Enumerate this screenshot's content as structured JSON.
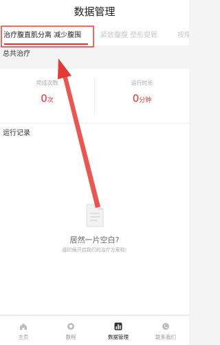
{
  "header": {
    "title": "数据管理"
  },
  "tabs": [
    {
      "label": "治疗腹直肌分离 减少腹围",
      "active": true
    },
    {
      "label": "紧致腹腹 塑形提臀",
      "active": false
    },
    {
      "label": "按摩",
      "active": false
    }
  ],
  "summary": {
    "title": "总共治疗",
    "completed": {
      "label": "完成次数",
      "value": "0",
      "unit": "次"
    },
    "duration": {
      "label": "运行时长",
      "value": "0",
      "unit": "分钟"
    }
  },
  "records": {
    "title": "运行记录",
    "empty_title": "居然一片空白?",
    "empty_subtitle": "是时候开启我们的治疗方案啦!"
  },
  "nav": [
    {
      "label": "主页",
      "icon": "home-icon",
      "active": false
    },
    {
      "label": "教程",
      "icon": "tutorial-icon",
      "active": false
    },
    {
      "label": "数据管理",
      "icon": "data-chart-icon",
      "active": true
    },
    {
      "label": "联系我们",
      "icon": "contact-icon",
      "active": false
    }
  ],
  "colors": {
    "accent": "#e03030",
    "annotation": "#e53935"
  }
}
